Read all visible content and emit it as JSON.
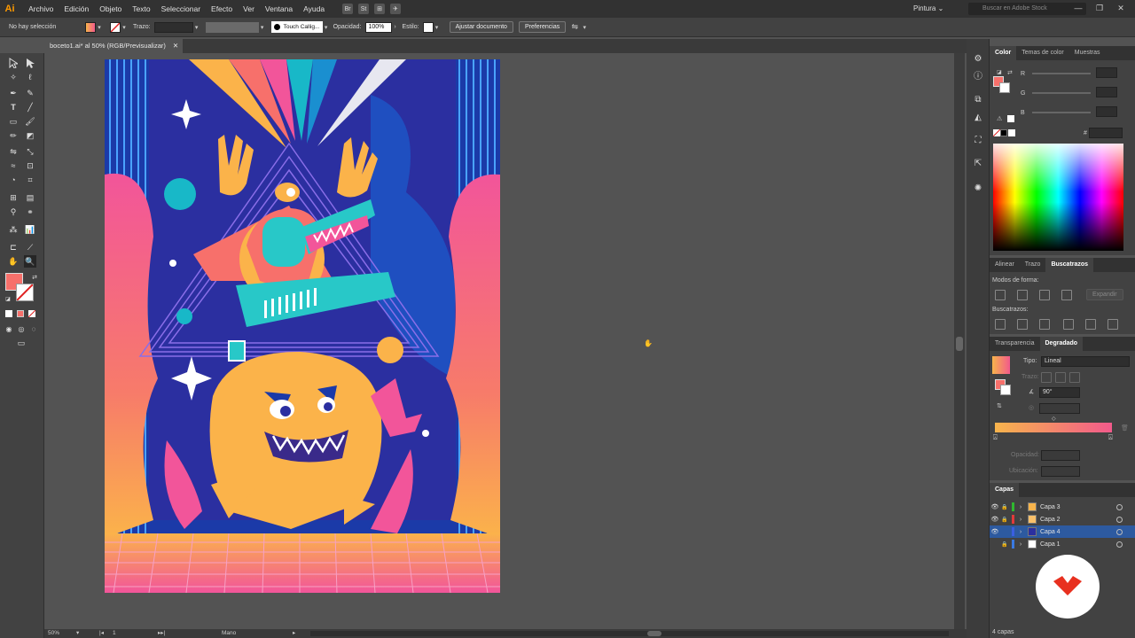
{
  "app": {
    "logo": "Ai",
    "workspace": "Pintura ⌄",
    "search_placeholder": "Buscar en Adobe Stock"
  },
  "menu": [
    "Archivo",
    "Edición",
    "Objeto",
    "Texto",
    "Seleccionar",
    "Efecto",
    "Ver",
    "Ventana",
    "Ayuda"
  ],
  "menu_icons": [
    "Br",
    "St",
    "⊞",
    "✈"
  ],
  "window_controls": [
    "—",
    "❐",
    "✕"
  ],
  "control_bar": {
    "selection_status": "No hay selección",
    "stroke_label": "Trazo:",
    "brush": "Touch Callig...",
    "opacity_label": "Opacidad:",
    "opacity_value": "100%",
    "style_label": "Estilo:",
    "doc_setup_button": "Ajustar documento",
    "preferences_button": "Preferencias"
  },
  "document_tab": {
    "title": "boceto1.ai* al 50% (RGB/Previsualizar)",
    "close": "✕"
  },
  "status_bar": {
    "zoom": "50%",
    "artboard": "1",
    "tool": "Mano"
  },
  "color_panel": {
    "tabs": [
      "Color",
      "Temas de color",
      "Muestras"
    ],
    "active_tab": "Color",
    "channels": [
      "R",
      "G",
      "B"
    ],
    "hex_symbol": "#"
  },
  "pathfinder_panel": {
    "tabs": [
      "Alinear",
      "Trazo",
      "Buscatrazos"
    ],
    "active_tab": "Buscatrazos",
    "shape_modes_label": "Modos de forma:",
    "expand_button": "Expandir",
    "pathfinders_label": "Buscatrazos:"
  },
  "gradient_panel": {
    "tabs": [
      "Transparencia",
      "Degradado"
    ],
    "active_tab": "Degradado",
    "type_label": "Tipo:",
    "type_value": "Lineal",
    "stroke_label": "Trazo:",
    "angle_value": "90°",
    "opacity_label": "Opacidad:",
    "location_label": "Ubicación:",
    "gradient_start": "#f7b44c",
    "gradient_end": "#f25a8b"
  },
  "layers_panel": {
    "title": "Capas",
    "layers": [
      {
        "name": "Capa 3",
        "color": "#2fb82f",
        "visible": true,
        "selected": false
      },
      {
        "name": "Capa 2",
        "color": "#e23a3a",
        "visible": true,
        "selected": false
      },
      {
        "name": "Capa 4",
        "color": "#3a5fe2",
        "visible": true,
        "selected": true
      },
      {
        "name": "Capa 1",
        "color": "#3a7ae2",
        "visible": false,
        "selected": false
      }
    ],
    "count": "4 capas"
  },
  "colors": {
    "accent": "#ff9a00",
    "fill": "#f7706b",
    "brand_red": "#e8301f"
  }
}
